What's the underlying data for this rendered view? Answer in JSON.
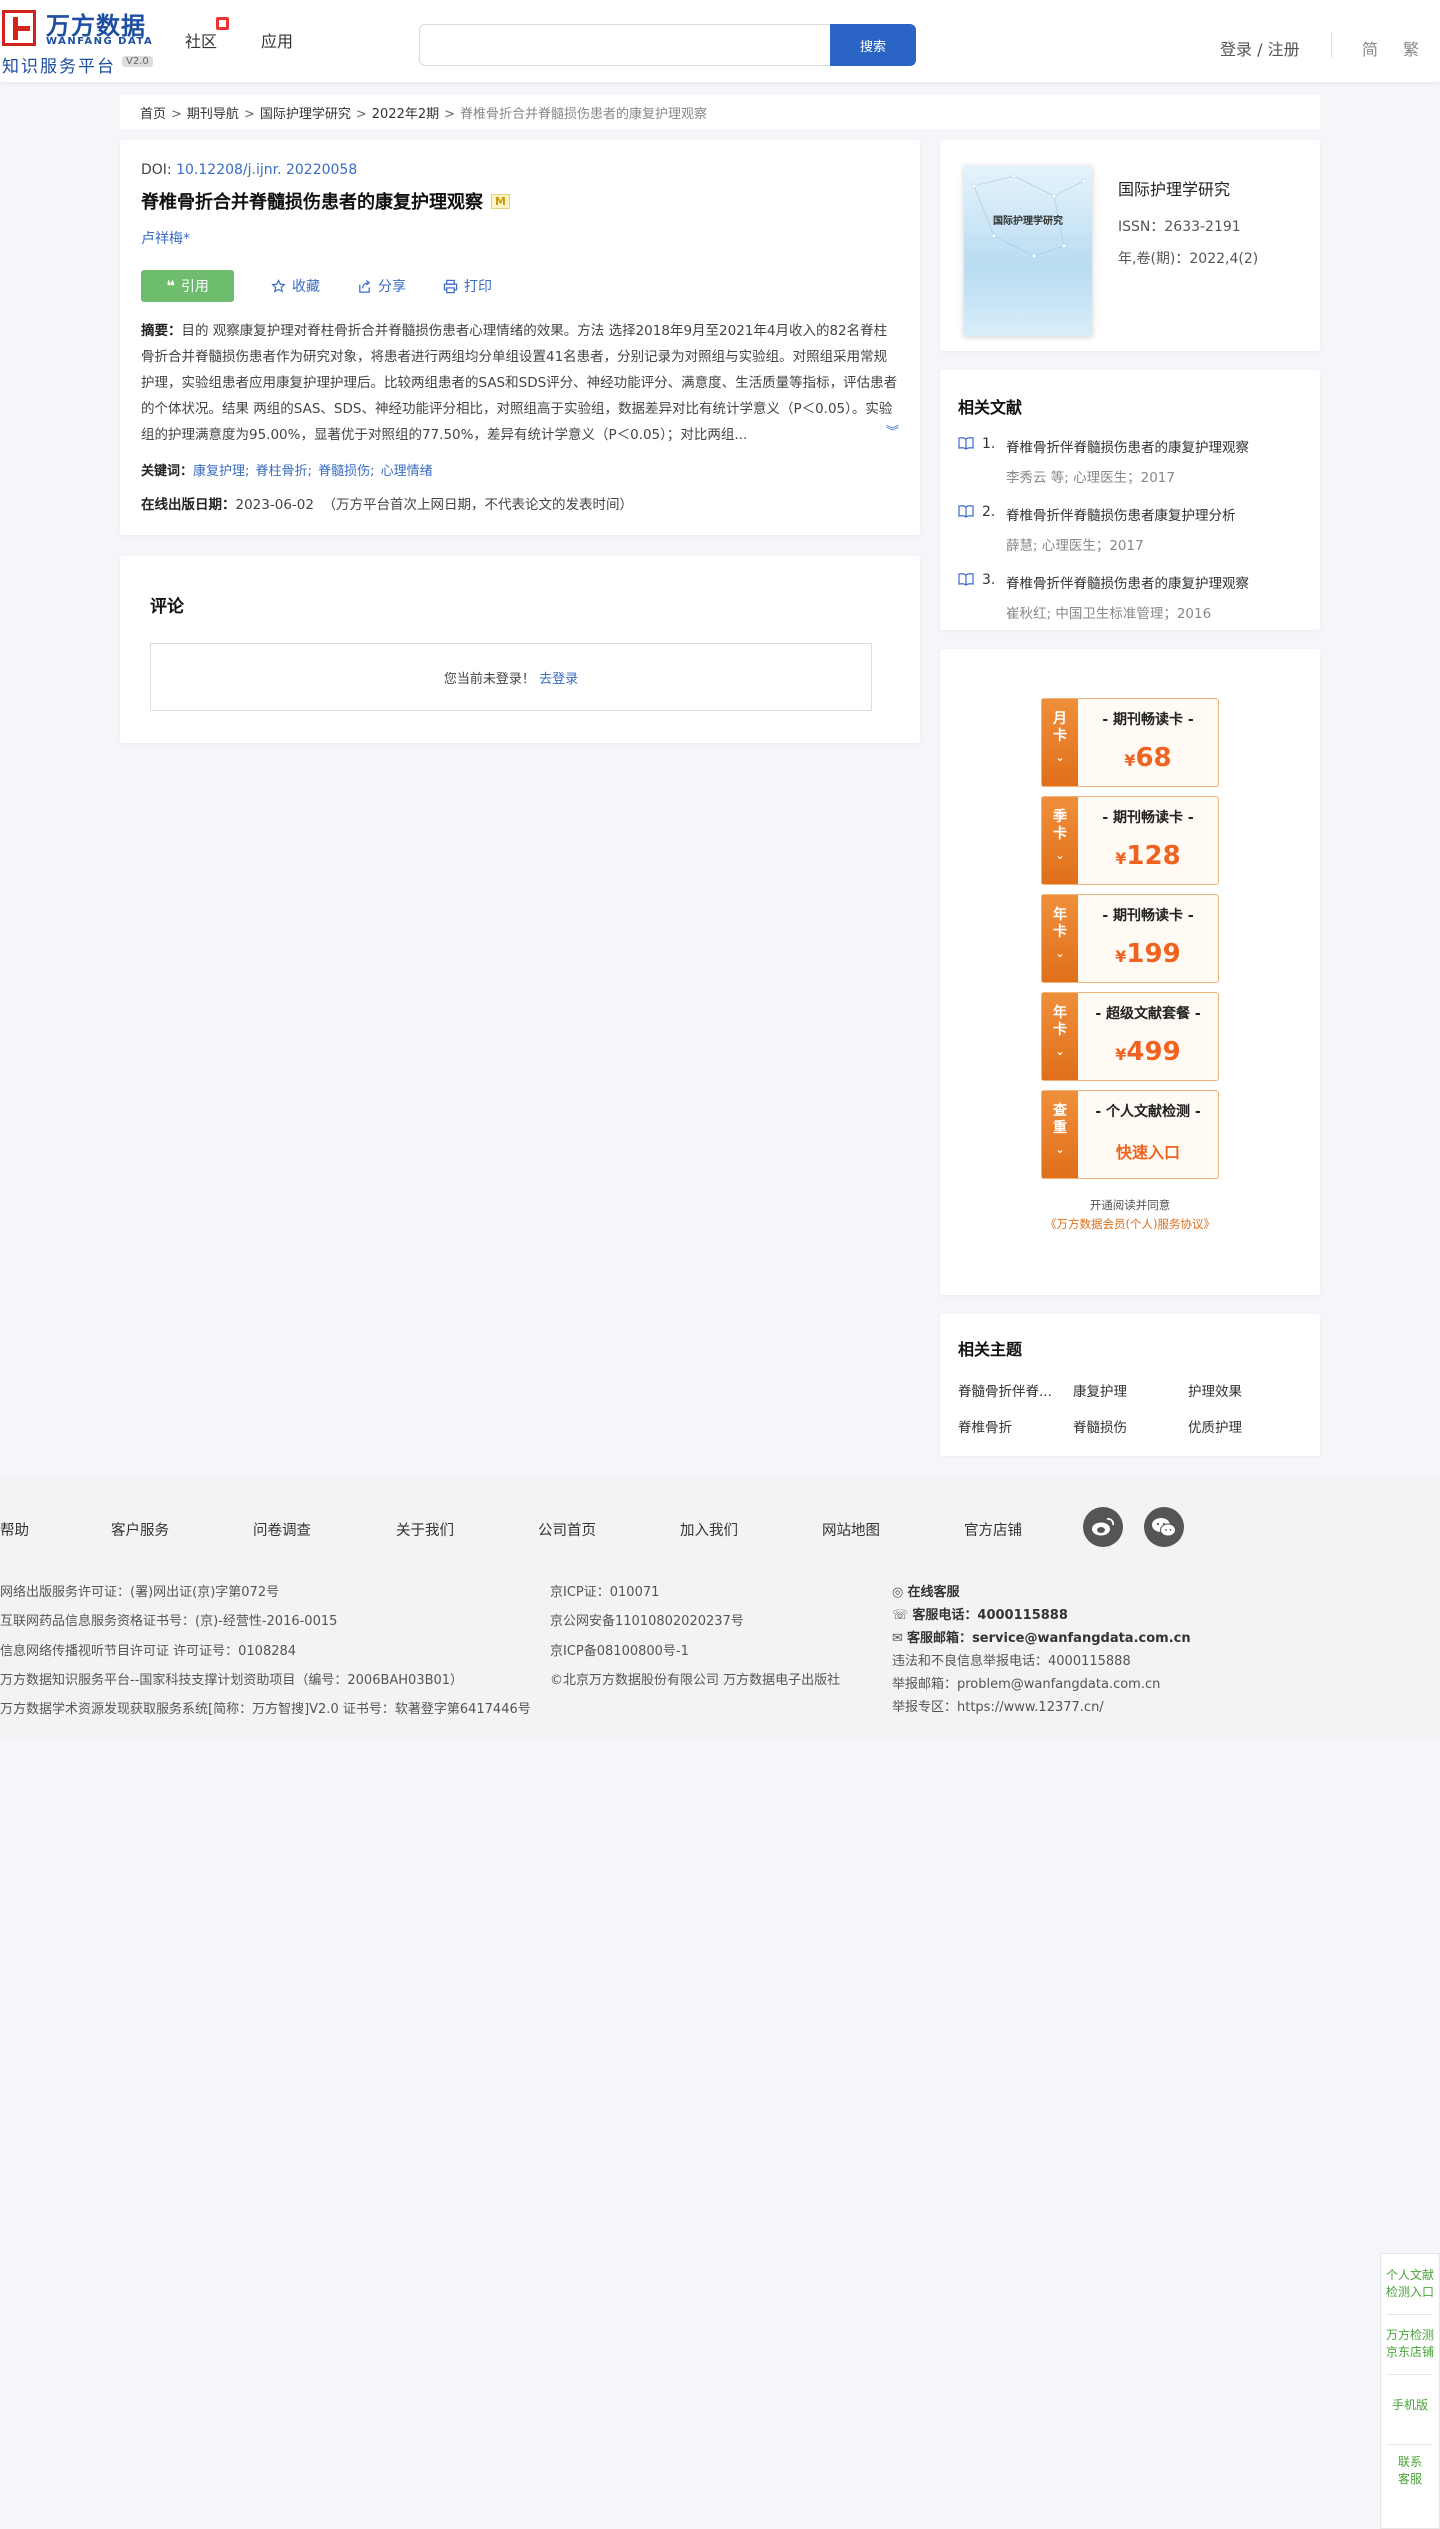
{
  "header": {
    "logo": {
      "title": "万方数据",
      "en": "WANFANG DATA",
      "subtitle": "知识服务平台",
      "version": "V2.0"
    },
    "nav": [
      "社区",
      "应用"
    ],
    "search": {
      "placeholder": "",
      "button": "搜索"
    },
    "login": "登录 / 注册",
    "lang": [
      "简",
      "繁"
    ]
  },
  "breadcrumb": [
    "首页",
    "期刊导航",
    "国际护理学研究",
    "2022年2期",
    "脊椎骨折合并脊髓损伤患者的康复护理观察"
  ],
  "article": {
    "doi_label": "DOI: ",
    "doi": "10.12208/j.ijnr. 20220058",
    "title": "脊椎骨折合并脊髓损伤患者的康复护理观察",
    "title_badge": "M",
    "author": "卢祥梅*",
    "actions": {
      "cite": "引用",
      "collect": "收藏",
      "share": "分享",
      "print": "打印"
    },
    "abstract_label": "摘要：",
    "abstract": "目的 观察康复护理对脊柱骨折合并脊髓损伤患者心理情绪的效果。方法 选择2018年9月至2021年4月收入的82名脊柱骨折合并脊髓损伤患者作为研究对象，将患者进行两组均分单组设置41名患者，分别记录为对照组与实验组。对照组采用常规护理，实验组患者应用康复护理护理后。比较两组患者的SAS和SDS评分、神经功能评分、满意度、生活质量等指标，评估患者的个体状况。结果 两组的SAS、SDS、神经功能评分相比，对照组高于实验组，数据差异对比有统计学意义（P＜0.05）。实验组的护理满意度为95.00%，显著优于对照组的77.50%，差异有统计学意义（P＜0.05）；对比两组...",
    "keywords_label": "关键词：",
    "keywords": [
      "康复护理;",
      "脊柱骨折;",
      "脊髓损伤;",
      "心理情绪"
    ],
    "pubdate_label": "在线出版日期：",
    "pubdate": "2023-06-02",
    "pubdate_note": "（万方平台首次上网日期，不代表论文的发表时间）"
  },
  "comments": {
    "title": "评论",
    "notice": "您当前未登录！",
    "login_link": "去登录"
  },
  "journal": {
    "cover_text": "国际护理学研究",
    "name": "国际护理学研究",
    "issn": "ISSN：2633-2191",
    "volume": "年,卷(期)：2022,4(2)"
  },
  "related": {
    "title": "相关文献",
    "items": [
      {
        "num": "1.",
        "title": "脊椎骨折伴脊髓损伤患者的康复护理观察",
        "meta": "李秀云  等;  心理医生；2017"
      },
      {
        "num": "2.",
        "title": "脊椎骨折伴脊髓损伤患者康复护理分析",
        "meta": "薛慧; 心理医生；2017"
      },
      {
        "num": "3.",
        "title": "脊椎骨折伴脊髓损伤患者的康复护理观察",
        "meta": "崔秋红; 中国卫生标准管理；2016"
      }
    ]
  },
  "membership": {
    "cards": [
      {
        "side": [
          "月",
          "卡"
        ],
        "name": "- 期刊畅读卡 -",
        "currency": "¥",
        "price": "68"
      },
      {
        "side": [
          "季",
          "卡"
        ],
        "name": "- 期刊畅读卡 -",
        "currency": "¥",
        "price": "128"
      },
      {
        "side": [
          "年",
          "卡"
        ],
        "name": "- 期刊畅读卡 -",
        "currency": "¥",
        "price": "199"
      },
      {
        "side": [
          "年",
          "卡"
        ],
        "name": "- 超级文献套餐 -",
        "currency": "¥",
        "price": "499"
      },
      {
        "side": [
          "查",
          "重"
        ],
        "name": "- 个人文献检测 -",
        "entry": "快速入口"
      }
    ],
    "agree_text": "开通阅读并同意",
    "agree_link": "《万方数据会员(个人)服务协议》"
  },
  "topics": {
    "title": "相关主题",
    "items": [
      "脊髓骨折伴脊...",
      "康复护理",
      "护理效果",
      "脊椎骨折",
      "脊髓损伤",
      "优质护理"
    ]
  },
  "footer": {
    "links": [
      "帮助",
      "客户服务",
      "问卷调查",
      "关于我们",
      "公司首页",
      "加入我们",
      "网站地图",
      "官方店铺"
    ],
    "col1": [
      "网络出版服务许可证：(署)网出证(京)字第072号",
      "互联网药品信息服务资格证书号：(京)-经营性-2016-0015",
      "信息网络传播视听节目许可证 许可证号：0108284",
      "万方数据知识服务平台--国家科技支撑计划资助项目（编号：2006BAH03B01）",
      "万方数据学术资源发现获取服务系统[简称：万方智搜]V2.0 证书号：软著登字第6417446号"
    ],
    "col2": [
      "京ICP证：010071",
      "京公网安备11010802020237号",
      "京ICP备08100800号-1",
      "©北京万方数据股份有限公司 万方数据电子出版社"
    ],
    "col3": {
      "online": "在线客服",
      "phone_label": "客服电话：",
      "phone": "4000115888",
      "email_label": "客服邮箱：",
      "email": "service@wanfangdata.com.cn",
      "report_phone": "违法和不良信息举报电话：4000115888",
      "report_email": "举报邮箱：problem@wanfangdata.com.cn",
      "report_site": "举报专区：https://www.12377.cn/"
    }
  },
  "side_panel": [
    [
      "个人文献",
      "检测入口"
    ],
    [
      "万方检测",
      "京东店铺"
    ],
    [
      "手机版"
    ],
    [
      "联系",
      "客服"
    ]
  ]
}
